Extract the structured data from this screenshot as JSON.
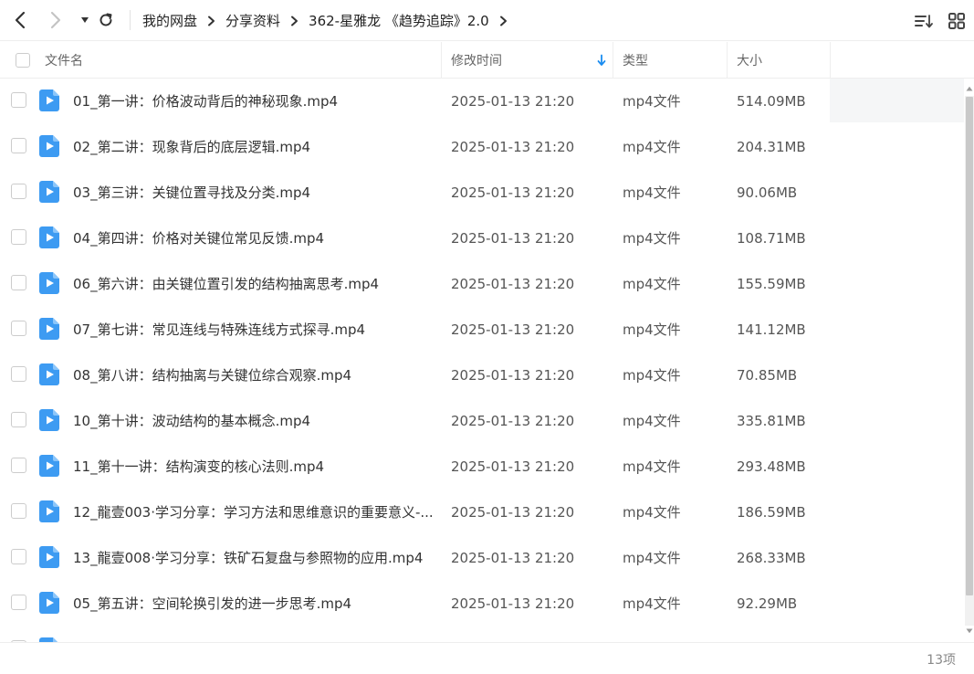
{
  "nav": {
    "back_icon": "chevron-left-icon",
    "forward_icon": "chevron-right-icon",
    "history_icon": "caret-down-icon",
    "refresh_icon": "refresh-icon"
  },
  "breadcrumb": [
    "我的网盘",
    "分享资料",
    "362-星雅龙 《趋势追踪》2.0"
  ],
  "toolbar": {
    "sort_icon": "sort-list-icon",
    "view_icon": "grid-view-icon"
  },
  "columns": {
    "name": "文件名",
    "mtime": "修改时间",
    "type": "类型",
    "size": "大小"
  },
  "sort": {
    "column": "mtime",
    "direction": "descending"
  },
  "colors": {
    "file_icon": "#3d9bf2",
    "accent": "#1a8cf0",
    "row_hover": "#f5f6f7"
  },
  "files": [
    {
      "name": "01_第一讲：价格波动背后的神秘现象.mp4",
      "mtime": "2025-01-13 21:20",
      "type": "mp4文件",
      "size": "514.09MB"
    },
    {
      "name": "02_第二讲：现象背后的底层逻辑.mp4",
      "mtime": "2025-01-13 21:20",
      "type": "mp4文件",
      "size": "204.31MB"
    },
    {
      "name": "03_第三讲：关键位置寻找及分类.mp4",
      "mtime": "2025-01-13 21:20",
      "type": "mp4文件",
      "size": "90.06MB"
    },
    {
      "name": "04_第四讲：价格对关键位常见反馈.mp4",
      "mtime": "2025-01-13 21:20",
      "type": "mp4文件",
      "size": "108.71MB"
    },
    {
      "name": "06_第六讲：由关键位置引发的结构抽离思考.mp4",
      "mtime": "2025-01-13 21:20",
      "type": "mp4文件",
      "size": "155.59MB"
    },
    {
      "name": "07_第七讲：常见连线与特殊连线方式探寻.mp4",
      "mtime": "2025-01-13 21:20",
      "type": "mp4文件",
      "size": "141.12MB"
    },
    {
      "name": "08_第八讲：结构抽离与关键位综合观察.mp4",
      "mtime": "2025-01-13 21:20",
      "type": "mp4文件",
      "size": "70.85MB"
    },
    {
      "name": "10_第十讲：波动结构的基本概念.mp4",
      "mtime": "2025-01-13 21:20",
      "type": "mp4文件",
      "size": "335.81MB"
    },
    {
      "name": "11_第十一讲：结构演变的核心法则.mp4",
      "mtime": "2025-01-13 21:20",
      "type": "mp4文件",
      "size": "293.48MB"
    },
    {
      "name": "12_龍壹003·学习分享：学习方法和思维意识的重要意义-...",
      "mtime": "2025-01-13 21:20",
      "type": "mp4文件",
      "size": "186.59MB"
    },
    {
      "name": "13_龍壹008·学习分享：铁矿石复盘与参照物的应用.mp4",
      "mtime": "2025-01-13 21:20",
      "type": "mp4文件",
      "size": "268.33MB"
    },
    {
      "name": "05_第五讲：空间轮换引发的进一步思考.mp4",
      "mtime": "2025-01-13 21:20",
      "type": "mp4文件",
      "size": "92.29MB"
    },
    {
      "name": "",
      "mtime": "",
      "type": "",
      "size": ""
    }
  ],
  "footer": {
    "count": "13项"
  }
}
